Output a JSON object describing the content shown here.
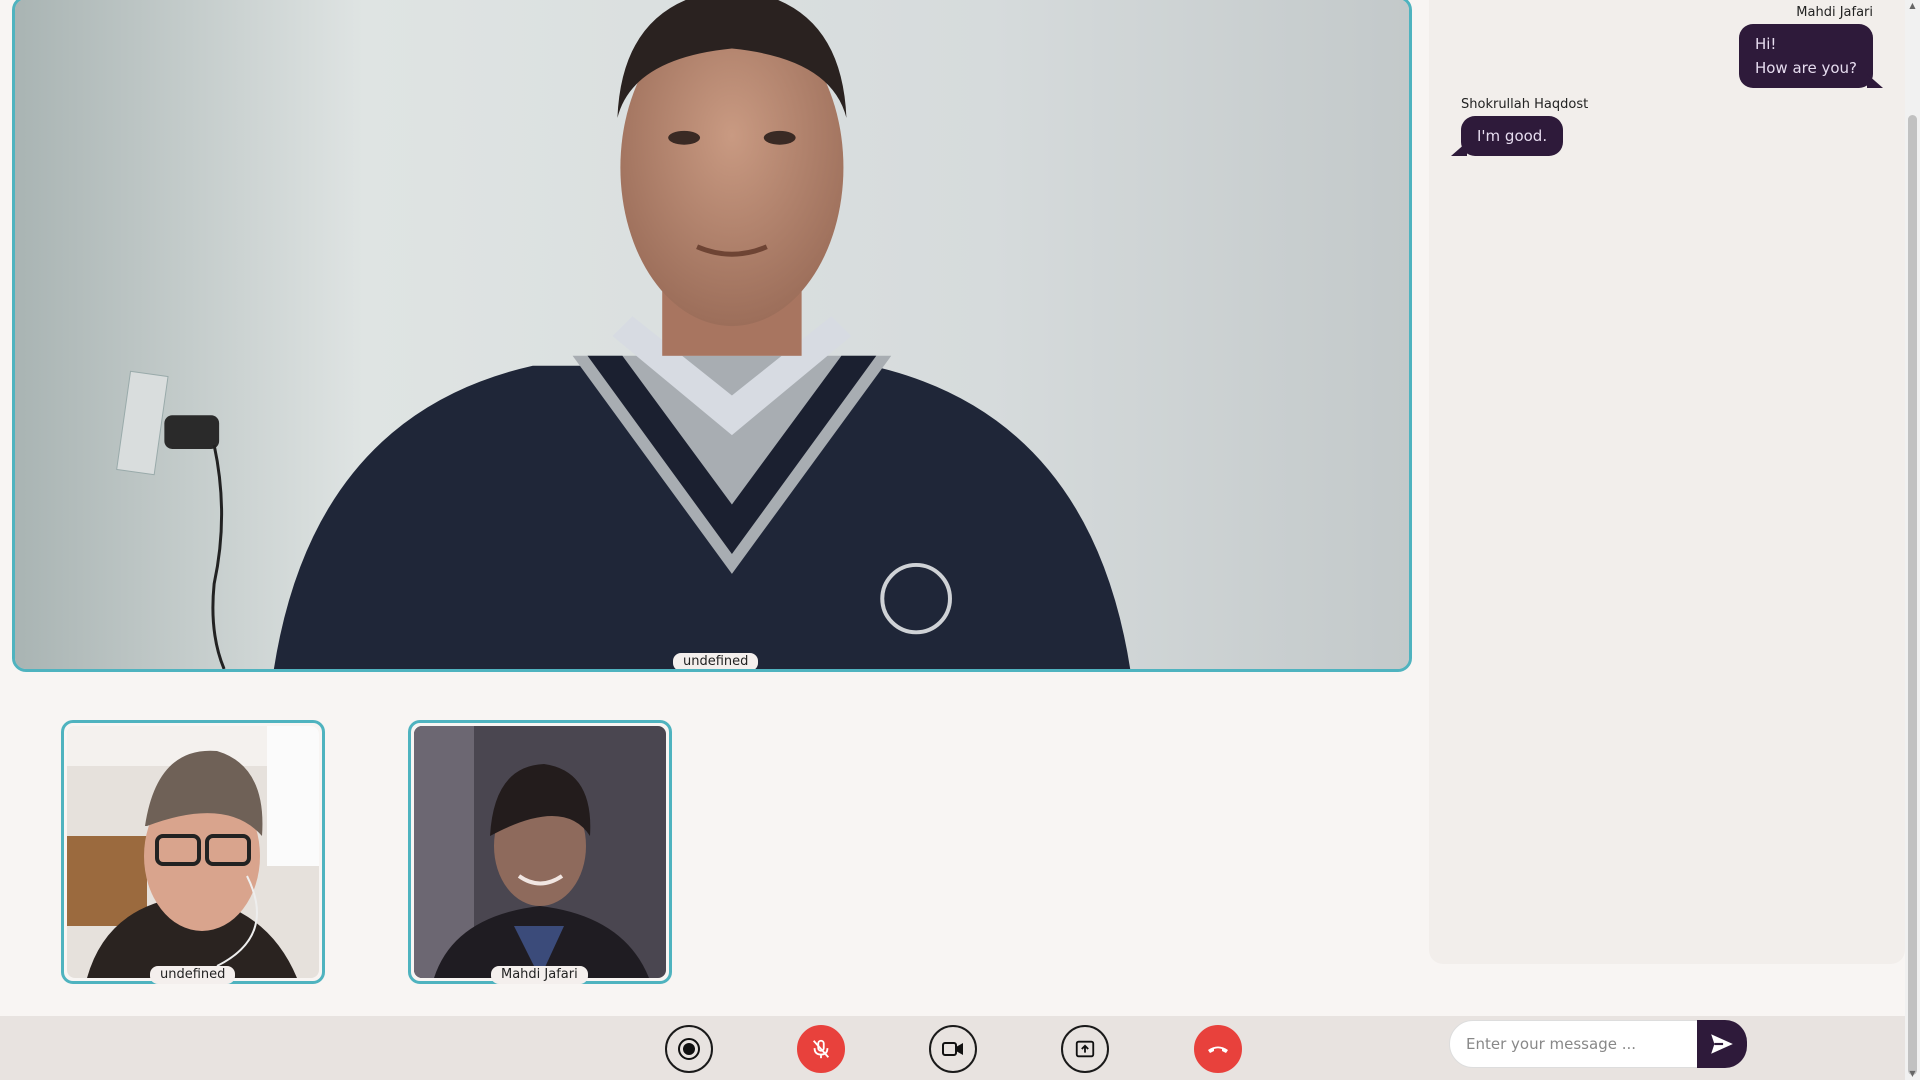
{
  "main_video": {
    "participant": "undefined"
  },
  "thumbnails": [
    {
      "participant": "undefined"
    },
    {
      "participant": "Mahdi Jafari"
    }
  ],
  "chat": {
    "messages": [
      {
        "sender": "Mahdi Jafari",
        "lines": [
          "Hi!",
          "How are you?"
        ],
        "side": "right"
      },
      {
        "sender": "Shokrullah Haqdost",
        "lines": [
          "I'm good."
        ],
        "side": "left"
      }
    ],
    "input": {
      "value": "",
      "placeholder": "Enter your message ..."
    }
  },
  "controls": [
    {
      "name": "record",
      "icon": "record-icon"
    },
    {
      "name": "mic",
      "icon": "mic-off-icon",
      "state": "muted",
      "color": "#e8413c"
    },
    {
      "name": "camera",
      "icon": "video-camera-icon"
    },
    {
      "name": "screen-share",
      "icon": "screen-share-icon"
    },
    {
      "name": "end-call",
      "icon": "phone-hangup-icon",
      "color": "#e8413c"
    }
  ],
  "colors": {
    "accent_border": "#4fb3bf",
    "bubble": "#2e1a3a",
    "danger": "#e8413c"
  }
}
